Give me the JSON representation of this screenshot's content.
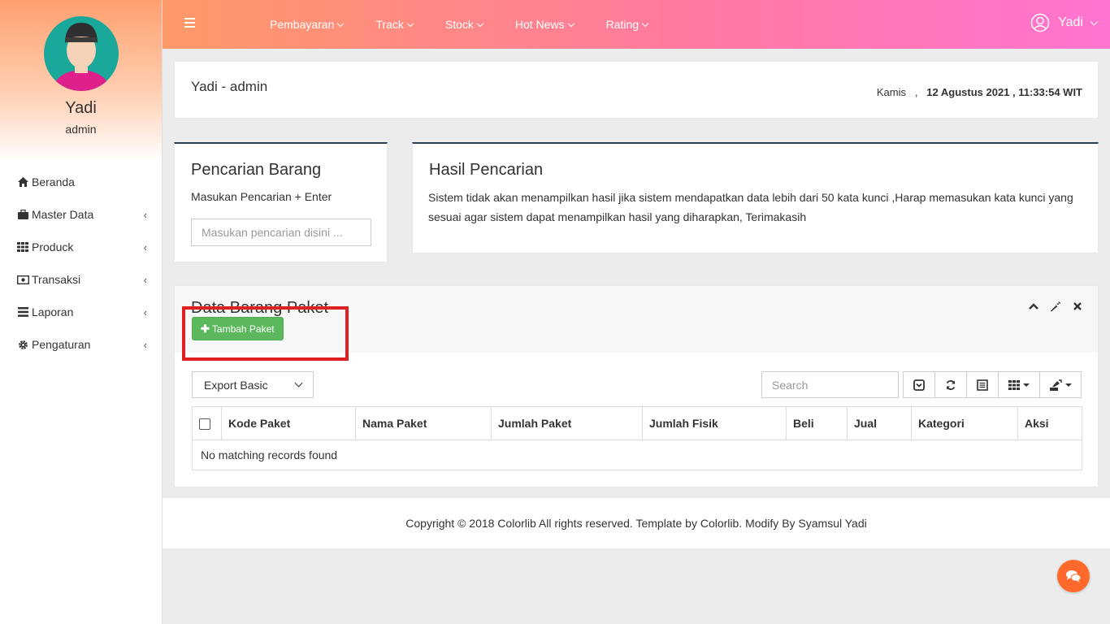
{
  "sidebar": {
    "profile_name": "Yadi",
    "profile_role": "admin",
    "items": [
      {
        "label": "Beranda",
        "icon": "home-icon"
      },
      {
        "label": "Master Data",
        "icon": "briefcase-icon"
      },
      {
        "label": "Produck",
        "icon": "grid-icon"
      },
      {
        "label": "Transaksi",
        "icon": "money-icon"
      },
      {
        "label": "Laporan",
        "icon": "list-icon"
      },
      {
        "label": "Pengaturan",
        "icon": "gear-icon"
      }
    ]
  },
  "topbar": {
    "nav": [
      "Pembayaran",
      "Track",
      "Stock",
      "Hot News",
      "Rating"
    ],
    "user_name": "Yadi"
  },
  "header": {
    "title": "Yadi - admin",
    "day": "Kamis",
    "separator": ",",
    "datetime": "12 Agustus 2021 , 11:33:54 WIT"
  },
  "search_panel": {
    "title": "Pencarian Barang",
    "subtitle": "Masukan Pencarian + Enter",
    "placeholder": "Masukan pencarian disini ..."
  },
  "result_panel": {
    "title": "Hasil Pencarian",
    "text": "Sistem tidak akan menampilkan hasil jika sistem mendapatkan data lebih dari 50 kata kunci ,Harap memasukan kata kunci yang sesuai agar sistem dapat menampilkan hasil yang diharapkan, Terimakasih"
  },
  "data_panel": {
    "title": "Data Barang Paket",
    "add_button": "Tambah Paket",
    "export_selected": "Export Basic",
    "search_placeholder": "Search",
    "columns": [
      "Kode Paket",
      "Nama Paket",
      "Jumlah Paket",
      "Jumlah Fisik",
      "Beli",
      "Jual",
      "Kategori",
      "Aksi"
    ],
    "empty_message": "No matching records found"
  },
  "footer": {
    "text": "Copyright © 2018 Colorlib All rights reserved. Template by Colorlib. Modify By Syamsul Yadi"
  },
  "colors": {
    "topbar_start": "#ff9967",
    "topbar_end": "#ff74d0",
    "accent_green": "#5cb85c",
    "highlight_red": "#e02020",
    "chat_orange": "#ff6a2c"
  }
}
